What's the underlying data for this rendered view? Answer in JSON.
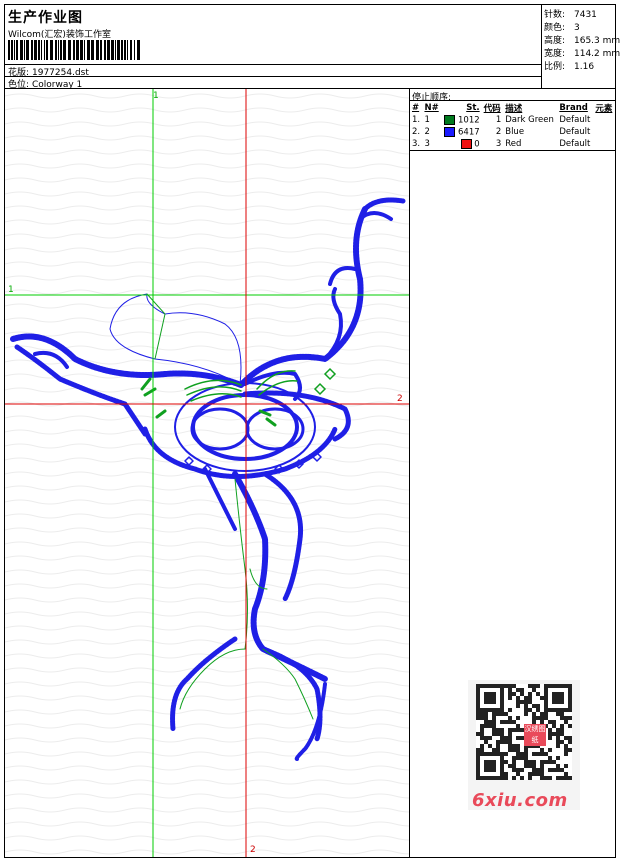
{
  "header": {
    "title": "生产作业图",
    "company": "Wilcom(汇宏)装饰工作室",
    "design_label": "花版:",
    "design_value": "1977254.dst",
    "colorway_label": "色位:",
    "colorway_value": "Colorway 1"
  },
  "stats": [
    {
      "label": "针数:",
      "value": "7431"
    },
    {
      "label": "颜色:",
      "value": "3"
    },
    {
      "label": "高度:",
      "value": "165.3 mm"
    },
    {
      "label": "宽度:",
      "value": "114.2 mm"
    },
    {
      "label": "比例:",
      "value": "1.16"
    }
  ],
  "canvas": {
    "axis_labels": {
      "v_green_top": "1",
      "h_green_left": "1",
      "h_red_right": "2",
      "v_red_bottom": "2"
    },
    "colors": {
      "green_axis": "#00cc00",
      "red_axis": "#dd0000"
    }
  },
  "sequence": {
    "title": "停止顺序:",
    "columns": [
      "#",
      "N#",
      "St.",
      "代码",
      "描述",
      "Brand",
      "元素"
    ],
    "rows": [
      {
        "index": "1.",
        "n": "1",
        "color": "#007a1e",
        "stitches": "1012",
        "code": "1",
        "desc": "Dark Green",
        "brand": "Default"
      },
      {
        "index": "2.",
        "n": "2",
        "color": "#1a1aff",
        "stitches": "6417",
        "code": "2",
        "desc": "Blue",
        "brand": "Default"
      },
      {
        "index": "3.",
        "n": "3",
        "color": "#ee1111",
        "stitches": "0",
        "code": "3",
        "desc": "Red",
        "brand": "Default"
      }
    ]
  },
  "watermark": {
    "site": "6xiu.com",
    "badge": "汉绣图纸"
  }
}
